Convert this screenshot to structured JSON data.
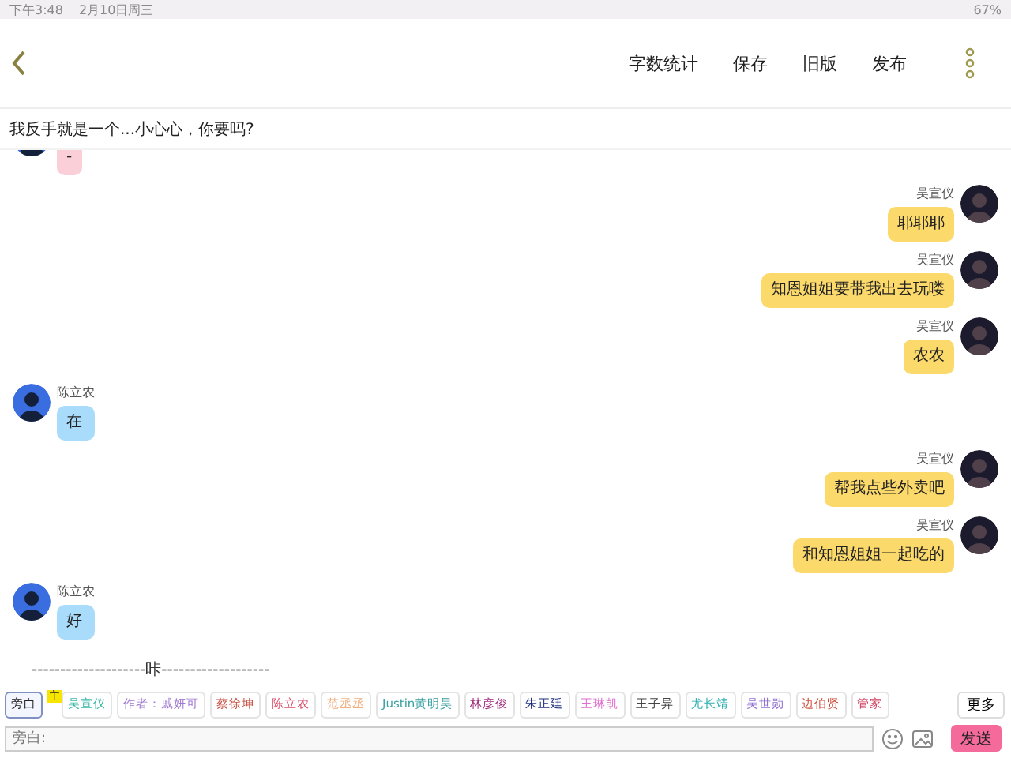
{
  "status_bar": {
    "time": "下午3:48",
    "date": "2月10日周三",
    "battery": "67%"
  },
  "header": {
    "actions": [
      "字数统计",
      "保存",
      "旧版",
      "发布"
    ]
  },
  "subtitle": "我反手就是一个...小心心，你要吗?",
  "messages": [
    {
      "kind": "incoming",
      "color": "#fbcfd8",
      "text": "-"
    },
    {
      "kind": "outgoing",
      "color": "#fbd96a",
      "name": "吴宣仪",
      "text": "耶耶耶"
    },
    {
      "kind": "outgoing",
      "color": "#fbd96a",
      "name": "吴宣仪",
      "text": "知恩姐姐要带我出去玩喽"
    },
    {
      "kind": "outgoing",
      "color": "#fbd96a",
      "name": "吴宣仪",
      "text": "农农"
    },
    {
      "kind": "incoming",
      "color": "#a8dcfa",
      "name": "陈立农",
      "text": "在"
    },
    {
      "kind": "outgoing",
      "color": "#fbd96a",
      "name": "吴宣仪",
      "text": "帮我点些外卖吧"
    },
    {
      "kind": "outgoing",
      "color": "#fbd96a",
      "name": "吴宣仪",
      "text": "和知恩姐姐一起吃的"
    },
    {
      "kind": "incoming",
      "color": "#a8dcfa",
      "name": "陈立农",
      "text": "好"
    }
  ],
  "scene_break": "--------------------咔-------------------",
  "characters": [
    {
      "label": "旁白",
      "color": "#222222",
      "selected": true
    },
    {
      "label": "吴宣仪",
      "color": "#3cb8a8",
      "selected": false,
      "badge": "主"
    },
    {
      "label": "作者：戚妍可",
      "color": "#a07ad0",
      "selected": false
    },
    {
      "label": "蔡徐坤",
      "color": "#c85040",
      "selected": false
    },
    {
      "label": "陈立农",
      "color": "#d8506a",
      "selected": false
    },
    {
      "label": "范丞丞",
      "color": "#f0b080",
      "selected": false
    },
    {
      "label": "Justin黄明昊",
      "color": "#3aa0a0",
      "selected": false
    },
    {
      "label": "林彦俊",
      "color": "#a03080",
      "selected": false
    },
    {
      "label": "朱正廷",
      "color": "#203080",
      "selected": false
    },
    {
      "label": "王琳凯",
      "color": "#e070d0",
      "selected": false
    },
    {
      "label": "王子异",
      "color": "#444444",
      "selected": false
    },
    {
      "label": "尤长靖",
      "color": "#30b0b0",
      "selected": false
    },
    {
      "label": "吴世勋",
      "color": "#9070d0",
      "selected": false
    },
    {
      "label": "边伯贤",
      "color": "#d05040",
      "selected": false
    },
    {
      "label": "管家",
      "color": "#d04060",
      "selected": false
    }
  ],
  "more_button": "更多",
  "input": {
    "placeholder": "旁白:"
  },
  "send_button": "发送"
}
